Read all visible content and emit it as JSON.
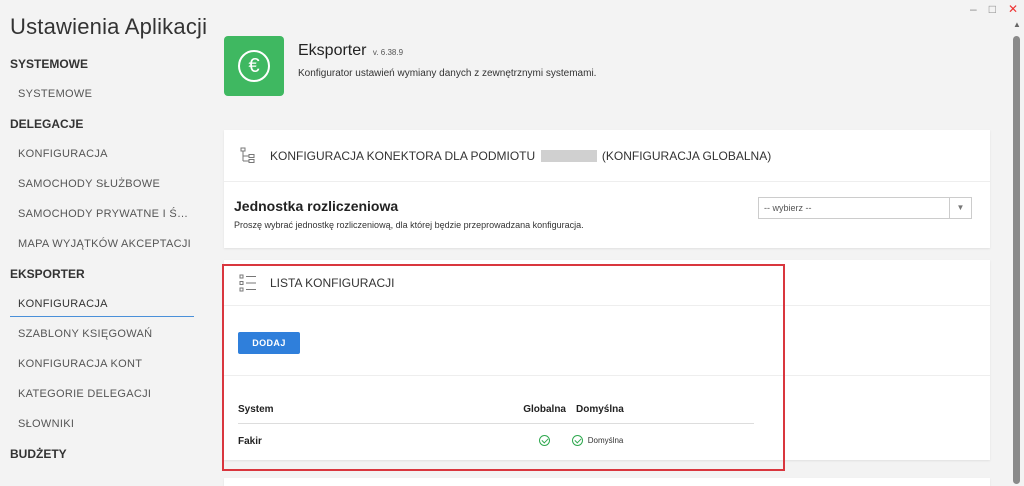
{
  "window": {
    "minimize": "–",
    "maximize": "□",
    "close": "✕"
  },
  "sidebar": {
    "title": "Ustawienia Aplikacji",
    "sections": [
      {
        "header": "SYSTEMOWE",
        "items": [
          {
            "label": "SYSTEMOWE"
          }
        ]
      },
      {
        "header": "DELEGACJE",
        "items": [
          {
            "label": "KONFIGURACJA"
          },
          {
            "label": "SAMOCHODY SŁUŻBOWE"
          },
          {
            "label": "SAMOCHODY PRYWATNE I ŚROD..."
          },
          {
            "label": "MAPA WYJĄTKÓW AKCEPTACJI"
          }
        ]
      },
      {
        "header": "EKSPORTER",
        "items": [
          {
            "label": "KONFIGURACJA",
            "active": true
          },
          {
            "label": "SZABLONY KSIĘGOWAŃ"
          },
          {
            "label": "KONFIGURACJA KONT"
          },
          {
            "label": "KATEGORIE DELEGACJI"
          },
          {
            "label": "SŁOWNIKI"
          }
        ]
      },
      {
        "header": "BUDŻETY",
        "items": []
      }
    ]
  },
  "header": {
    "icon_symbol": "€",
    "app_name": "Eksporter",
    "version": "v. 6.38.9",
    "description": "Konfigurator ustawień wymiany danych z zewnętrznymi systemami."
  },
  "connector_card": {
    "title_prefix": "KONFIGURACJA KONEKTORA DLA PODMIOTU",
    "title_suffix": "(KONFIGURACJA GLOBALNA)",
    "field_title": "Jednostka rozliczeniowa",
    "field_help": "Proszę wybrać jednostkę rozliczeniową, dla której będzie przeprowadzana konfiguracja.",
    "select_value": "-- wybierz --"
  },
  "config_list": {
    "title": "LISTA KONFIGURACJI",
    "add_label": "DODAJ",
    "columns": {
      "system": "System",
      "global": "Globalna",
      "default": "Domyślna"
    },
    "rows": [
      {
        "system": "Fakir",
        "global": true,
        "default": true,
        "default_label": "Domyślna"
      }
    ]
  },
  "colors": {
    "accent": "#2f7fdb",
    "icon_bg": "#3fb861",
    "check": "#2fa84f",
    "highlight": "#d9363e"
  }
}
